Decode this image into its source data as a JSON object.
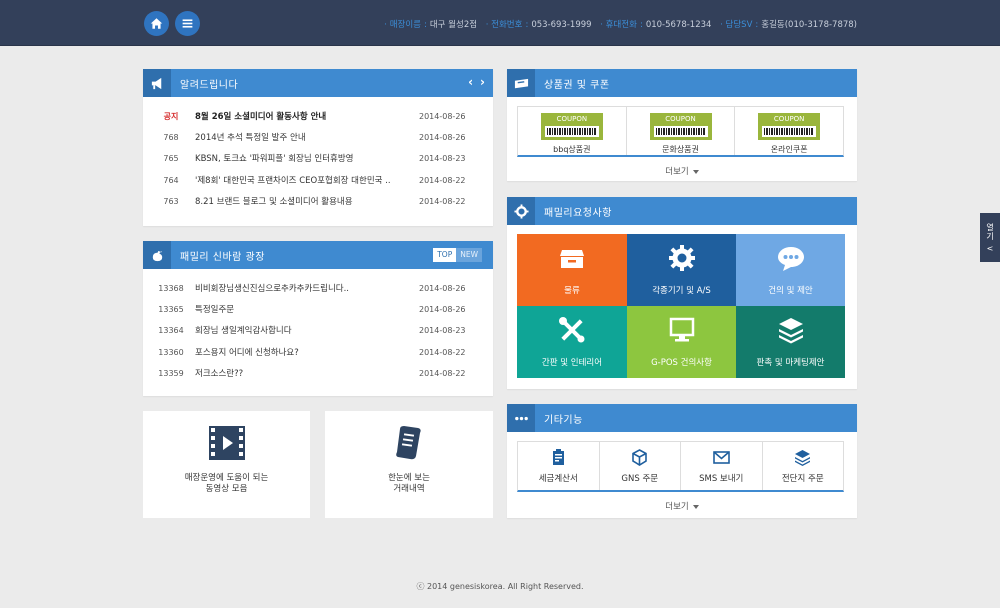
{
  "header": {
    "store_label": "매장이름",
    "store_value": "대구 월성2점",
    "phone_label": "전화번호",
    "phone_value": "053-693-1999",
    "mobile_label": "휴대전화",
    "mobile_value": "010-5678-1234",
    "sv_label": "담당SV",
    "sv_value": "홍길동(010-3178-7878)",
    "home_icon": "home-icon",
    "menu_icon": "menu-icon"
  },
  "notice": {
    "title": "알려드립니다",
    "rows": [
      {
        "no": "공지",
        "title": "8월 26일 소셜미디어 활동사항 안내",
        "date": "2014-08-26"
      },
      {
        "no": "768",
        "title": "2014년 추석 특정일 발주 안내",
        "date": "2014-08-26"
      },
      {
        "no": "765",
        "title": "KBSN, 토크쇼 '파워피플' 회장님 인터휴방영",
        "date": "2014-08-23"
      },
      {
        "no": "764",
        "title": "'제8회' 대한민국 프랜차이즈 CEO포협회장 대한민국 ..",
        "date": "2014-08-22"
      },
      {
        "no": "763",
        "title": "8.21 브랜드 블로그 및 소셜미디어 활용내용",
        "date": "2014-08-22"
      }
    ]
  },
  "family": {
    "title": "패밀리 신바람 광장",
    "tab_top": "TOP",
    "tab_new": "NEW",
    "rows": [
      {
        "no": "13368",
        "title": "비비회장님생신진심으로추카추카드립니다..",
        "date": "2014-08-26"
      },
      {
        "no": "13365",
        "title": "특정일주문",
        "date": "2014-08-26"
      },
      {
        "no": "13364",
        "title": "회장님 생일계익감사합니다",
        "date": "2014-08-23"
      },
      {
        "no": "13360",
        "title": "포스용지 어디에 신청하나요?",
        "date": "2014-08-22"
      },
      {
        "no": "13359",
        "title": "저크소스란??",
        "date": "2014-08-22"
      }
    ]
  },
  "video": {
    "line1": "매장운영에 도움이 되는",
    "line2": "동영상 모음"
  },
  "ledger": {
    "line1": "한눈에 보는",
    "line2": "거래내역"
  },
  "coupons": {
    "title": "상품권 및 쿠폰",
    "items": [
      {
        "tag": "COUPON",
        "name": "bbq상품권"
      },
      {
        "tag": "COUPON",
        "name": "문화상품권"
      },
      {
        "tag": "COUPON",
        "name": "온라인쿠폰"
      }
    ],
    "more": "더보기"
  },
  "requests": {
    "title": "패밀리요청사항",
    "tiles": [
      {
        "label": "물류",
        "color": "#f26a21",
        "icon": "box-icon"
      },
      {
        "label": "각종기기 및 A/S",
        "color": "#1f5f9e",
        "icon": "gear-icon"
      },
      {
        "label": "건의 및 제안",
        "color": "#6fa8e4",
        "icon": "chat-icon"
      },
      {
        "label": "간판 및 인테리어",
        "color": "#0fa596",
        "icon": "tools-icon"
      },
      {
        "label": "G-POS 건의사항",
        "color": "#8dc63f",
        "icon": "monitor-icon"
      },
      {
        "label": "판촉 및 마케팅제안",
        "color": "#137b6b",
        "icon": "layers-icon"
      }
    ]
  },
  "etc": {
    "title": "기타기능",
    "items": [
      {
        "label": "세금계산서",
        "icon": "receipt-icon"
      },
      {
        "label": "GNS 주문",
        "icon": "cube-icon"
      },
      {
        "label": "SMS 보내기",
        "icon": "mail-icon"
      },
      {
        "label": "전단지 주문",
        "icon": "layers-icon"
      }
    ],
    "more": "더보기"
  },
  "side_tab": {
    "line1": "열",
    "line2": "기",
    "arrow": "<"
  },
  "footer": "ⓒ 2014 genesiskorea. All Right Reserved."
}
